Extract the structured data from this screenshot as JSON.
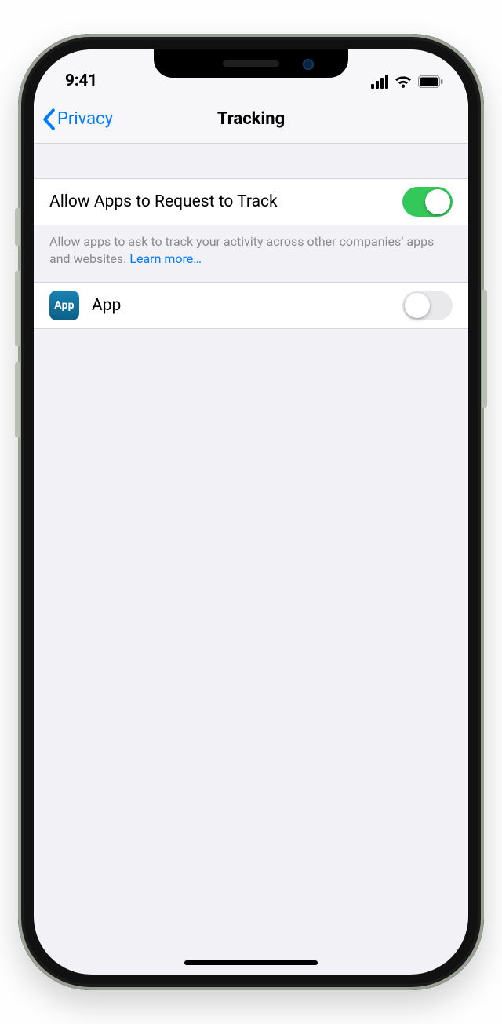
{
  "status": {
    "time": "9:41"
  },
  "nav": {
    "back_label": "Privacy",
    "title": "Tracking"
  },
  "settings": {
    "allow_label": "Allow Apps to Request to Track",
    "allow_on": true,
    "footer_text": "Allow apps to ask to track your activity across other companies’ apps and websites. ",
    "learn_more": "Learn more…"
  },
  "apps": [
    {
      "icon_text": "App",
      "name": "App",
      "on": false
    }
  ]
}
